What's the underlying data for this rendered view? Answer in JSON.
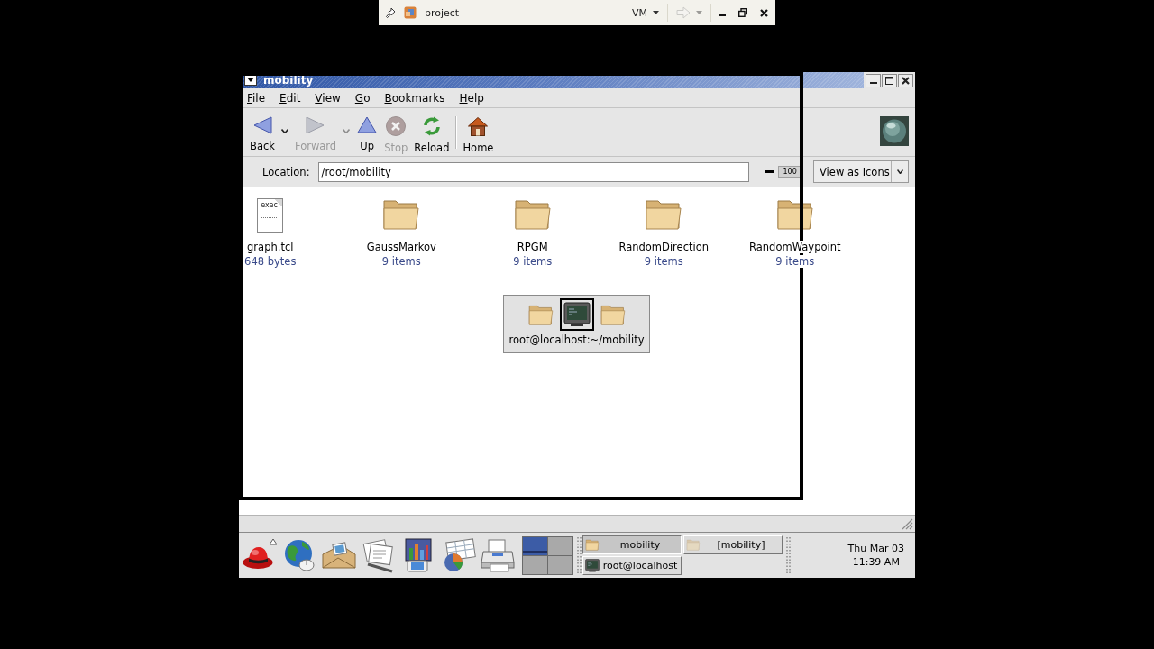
{
  "vm_toolbar": {
    "title": "project",
    "menu": "VM",
    "forward_button": {
      "disabled": true
    }
  },
  "window": {
    "title": "mobility",
    "menu": [
      "File",
      "Edit",
      "View",
      "Go",
      "Bookmarks",
      "Help"
    ],
    "toolbar": [
      {
        "kind": "back",
        "label": "Back",
        "disabled": false,
        "dropdown": true
      },
      {
        "kind": "forward",
        "label": "Forward",
        "disabled": true,
        "dropdown": true
      },
      {
        "kind": "up",
        "label": "Up",
        "disabled": false,
        "dropdown": false
      },
      {
        "kind": "stop",
        "label": "Stop",
        "disabled": true,
        "dropdown": false
      },
      {
        "kind": "reload",
        "label": "Reload",
        "disabled": false,
        "dropdown": false
      },
      {
        "kind": "separator"
      },
      {
        "kind": "home",
        "label": "Home",
        "disabled": false,
        "dropdown": false
      }
    ],
    "location": {
      "label": "Location:",
      "value": "/root/mobility"
    },
    "zoom_level": "100",
    "view_mode": "View as Icons",
    "items": [
      {
        "kind": "file",
        "name": "graph.tcl",
        "info": "648 bytes",
        "preview": "exec"
      },
      {
        "kind": "folder",
        "name": "GaussMarkov",
        "info": "9 items"
      },
      {
        "kind": "folder",
        "name": "RPGM",
        "info": "9 items"
      },
      {
        "kind": "folder",
        "name": "RandomDirection",
        "info": "9 items"
      },
      {
        "kind": "folder",
        "name": "RandomWaypoint",
        "info": "9 items"
      }
    ]
  },
  "window_switcher": {
    "windows": [
      {
        "kind": "folder",
        "selected": false
      },
      {
        "kind": "terminal",
        "selected": true
      },
      {
        "kind": "folder",
        "selected": false
      }
    ],
    "label": "root@localhost:~/mobility"
  },
  "panel": {
    "launchers": [
      {
        "kind": "main-menu"
      },
      {
        "kind": "browser"
      },
      {
        "kind": "mail"
      },
      {
        "kind": "writer"
      },
      {
        "kind": "presentation"
      },
      {
        "kind": "spreadsheet"
      },
      {
        "kind": "printer"
      }
    ],
    "workspaces": [
      {
        "selected": true
      },
      {
        "selected": false
      },
      {
        "selected": false
      },
      {
        "selected": false
      }
    ],
    "tasks": [
      {
        "kind": "folder",
        "label": "mobility",
        "selected": true,
        "minimized": false
      },
      {
        "kind": "folder",
        "label": "[mobility]",
        "selected": false,
        "minimized": true
      },
      {
        "kind": "terminal",
        "label": "root@localhost",
        "selected": false,
        "minimized": false
      }
    ],
    "clock": {
      "date": "Thu Mar 03",
      "time": "11:39 AM"
    }
  }
}
